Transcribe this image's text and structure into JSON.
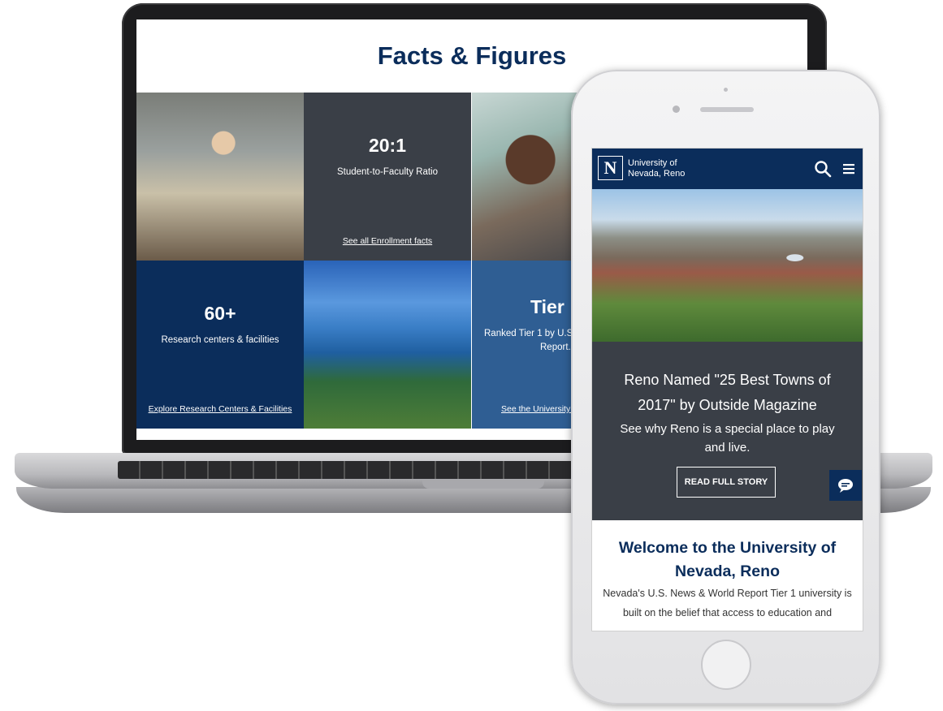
{
  "laptop": {
    "heading": "Facts & Figures",
    "tiles": {
      "ratio": {
        "value": "20:1",
        "label": "Student-to-Faculty Ratio",
        "link": "See all Enrollment facts"
      },
      "research": {
        "value": "60+",
        "label": "Research centers & facilities",
        "link": "Explore Research Centers & Facilities"
      },
      "tier": {
        "value": "Tier",
        "label_line1": "Ranked Tier 1 by U.S.",
        "label_line2": "Report.",
        "link": "See the University i"
      }
    }
  },
  "phone": {
    "brand_line1": "University of",
    "brand_line2": "Nevada, Reno",
    "logo_letter": "N",
    "story": {
      "title": "Reno Named \"25 Best Towns of 2017\" by Outside Magazine",
      "subtitle": "See why Reno is a special place to play and live.",
      "button": "READ FULL STORY"
    },
    "welcome_title": "Welcome to the University of Nevada, Reno",
    "welcome_body": "Nevada's U.S. News & World Report Tier 1 university is built on the belief that access to education and"
  },
  "colors": {
    "navy": "#0b2d5b",
    "slate": "#3a3f47",
    "mid_blue": "#2f5e93"
  }
}
